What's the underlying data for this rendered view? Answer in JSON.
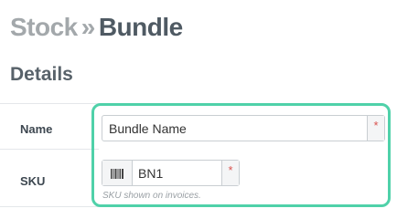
{
  "header": {
    "breadcrumb": "Stock",
    "separator": "»",
    "page_title": "Bundle"
  },
  "section": {
    "title": "Details"
  },
  "form": {
    "name": {
      "label": "Name",
      "value": "Bundle Name",
      "required_marker": "*"
    },
    "sku": {
      "label": "SKU",
      "value": "BN1",
      "required_marker": "*",
      "help_text": "SKU shown on invoices.",
      "icon": "barcode-icon"
    }
  },
  "colors": {
    "focus_ring": "#4fd1a9",
    "required": "#d9534f"
  }
}
